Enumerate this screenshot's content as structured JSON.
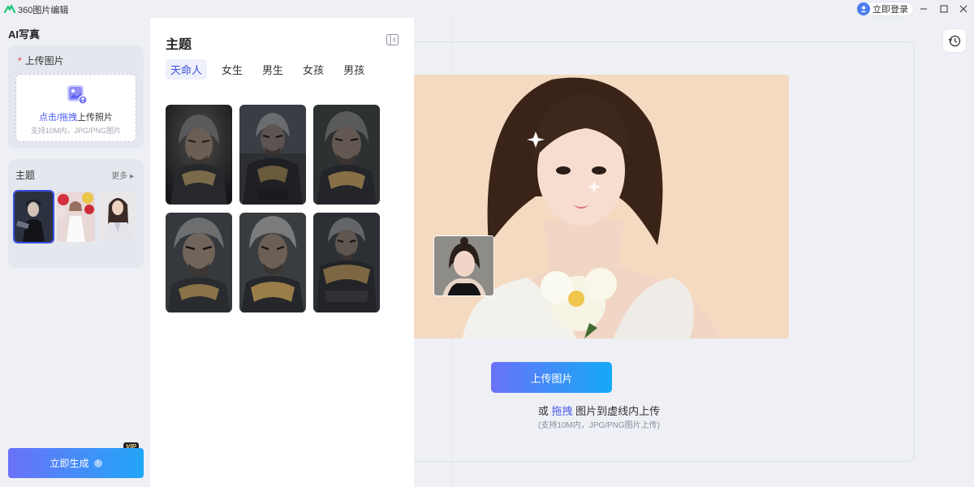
{
  "app": {
    "title": "360图片编辑",
    "login_label": "立即登录"
  },
  "left_panel": {
    "title": "AI写真",
    "upload": {
      "label": "上传图片",
      "required_mark": "*",
      "link_text": "点击/拖拽",
      "text": "上传照片",
      "hint": "支持10M内，JPG/PNG图片"
    },
    "themes": {
      "label": "主题",
      "more_label": "更多 ▸",
      "thumbs": [
        "dark-warrior",
        "girl-with-balloons",
        "business-woman"
      ]
    },
    "generate_label": "立即生成",
    "vip_badge": "VIP"
  },
  "theme_panel": {
    "title": "主题",
    "tabs": [
      "天命人",
      "女生",
      "男生",
      "女孩",
      "男孩"
    ],
    "active_tab": "天命人",
    "images": [
      "monkey-king-1",
      "monkey-king-2",
      "monkey-king-3",
      "monkey-king-4",
      "monkey-king-5",
      "monkey-king-6"
    ]
  },
  "canvas": {
    "upload_button": "上传图片",
    "hint_prefix": "或",
    "hint_link": "拖拽",
    "hint_suffix": "图片到虚线内上传",
    "sub_hint": "(支持10M内，JPG/PNG图片上传)"
  },
  "colors": {
    "accent": "#3b4fe0",
    "gradient_start": "#6a72f8",
    "gradient_end": "#14aaf7",
    "photo_bg": "#f4dac1"
  }
}
